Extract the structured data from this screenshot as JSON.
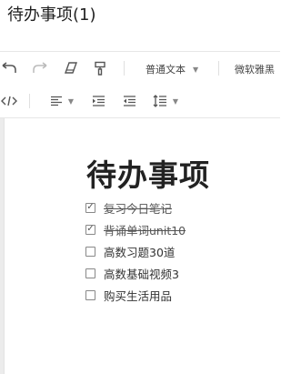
{
  "window": {
    "title": "待办事项(1)"
  },
  "toolbar": {
    "paragraph_style": "普通文本",
    "font_family": "微软雅黑"
  },
  "document": {
    "heading": "待办事项",
    "todos": [
      {
        "text": "复习今日笔记",
        "checked": true
      },
      {
        "text": "背诵单词unit10",
        "checked": true
      },
      {
        "text": "高数习题30道",
        "checked": false
      },
      {
        "text": "高数基础视频3",
        "checked": false
      },
      {
        "text": "购买生活用品",
        "checked": false
      }
    ]
  }
}
